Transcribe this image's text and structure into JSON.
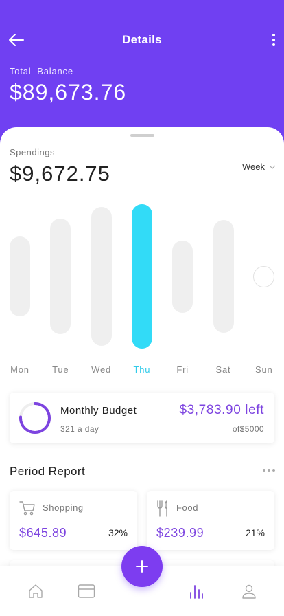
{
  "header": {
    "title": "Details",
    "back_icon": "arrow-left-icon",
    "more_icon": "more-vertical-icon",
    "balance_label": "Total  Balance",
    "balance_value": "$89,673.76"
  },
  "spendings": {
    "label": "Spendings",
    "value": "$9,672.75",
    "period": "Week",
    "chevron_icon": "chevron-down-icon"
  },
  "chart_data": {
    "type": "bar",
    "categories": [
      "Mon",
      "Tue",
      "Wed",
      "Thu",
      "Fri",
      "Sat",
      "Sun"
    ],
    "values": [
      0.55,
      0.8,
      0.96,
      1.0,
      0.5,
      0.78,
      0.14
    ],
    "highlighted": "Thu",
    "highlight_color": "#32dbf7",
    "bar_color": "#efefef"
  },
  "budget": {
    "title": "Monthly Budget",
    "subtitle": "321 a day",
    "left": "$3,783.90 left",
    "total": "of$5000",
    "progress": 0.76
  },
  "report": {
    "title": "Period Report",
    "more_icon": "more-horizontal-icon",
    "categories": [
      {
        "name": "Shopping",
        "icon": "shopping-cart-icon",
        "amount": "$645.89",
        "percent": "32%"
      },
      {
        "name": "Food",
        "icon": "fork-knife-icon",
        "amount": "$239.99",
        "percent": "21%"
      }
    ]
  },
  "tabbar": {
    "tabs": [
      {
        "name": "home",
        "icon": "home-icon"
      },
      {
        "name": "cards",
        "icon": "card-icon"
      },
      {
        "name": "stats",
        "icon": "stats-icon",
        "active": true
      },
      {
        "name": "profile",
        "icon": "user-icon"
      }
    ],
    "fab_icon": "plus-icon"
  },
  "colors": {
    "primary": "#7040f2",
    "accent": "#7d44e0",
    "highlight": "#32dbf7"
  }
}
